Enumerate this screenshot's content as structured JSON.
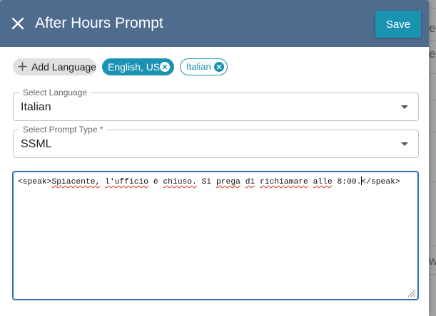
{
  "dialog": {
    "title": "After Hours Prompt",
    "save_label": "Save"
  },
  "chips": {
    "add_language": "Add Language",
    "languages": [
      "English, US",
      "Italian"
    ]
  },
  "select_language": {
    "label": "Select Language",
    "value": "Italian"
  },
  "select_prompt_type": {
    "label": "Select Prompt Type *",
    "value": "SSML"
  },
  "editor": {
    "tag_open": "<speak>",
    "words": [
      "Spiacente,",
      "l'ufficio",
      "è",
      "chiuso.",
      "Si",
      "prega",
      "di",
      "richiamare",
      "alle",
      "8:00."
    ],
    "tag_close": "</speak>"
  },
  "background": {
    "fragments": [
      "e",
      "e",
      "w"
    ]
  },
  "colors": {
    "header": "#4f6b8e",
    "accent": "#1a93b3",
    "focus_border": "#2d72b8",
    "spellcheck": "#d93025"
  },
  "icons": {
    "close": "close-icon",
    "add": "plus-icon",
    "chip_remove": "cancel-circle-icon",
    "dropdown": "chevron-down-icon",
    "resize": "resize-handle-icon"
  }
}
